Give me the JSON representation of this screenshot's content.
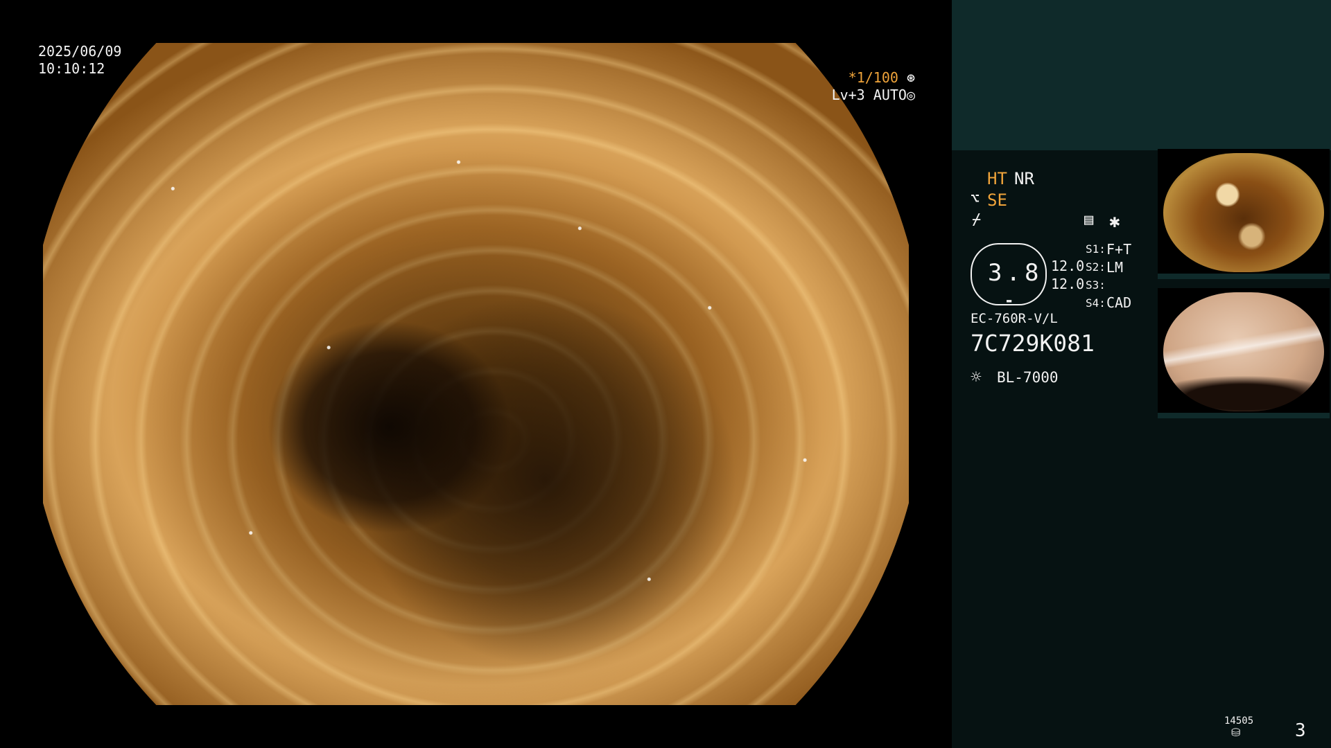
{
  "osd": {
    "date": "2025/06/09",
    "time": "10:10:12",
    "shutter": "*1/100",
    "level": "Lv+3",
    "auto": "AUTO"
  },
  "panel": {
    "mode1": "HT",
    "mode2": "NR",
    "mode3": "SE",
    "brightness": "3.8",
    "val1": "12.0",
    "val2": "12.0",
    "s1_label": "S1:",
    "s1_value": "F+T",
    "s2_label": "S2:",
    "s2_value": "LM",
    "s3_label": "S3:",
    "s3_value": "",
    "s4_label": "S4:",
    "s4_value": "CAD",
    "scope_model": "EC-760R-V/L",
    "scope_serial": "7C729K081",
    "light_source": "BL-7000",
    "counter": "14505",
    "page_number": "3"
  },
  "colors": {
    "orange_accent": "#f0a43a",
    "panel_bg": "#061212",
    "panel_top_bg": "#0f2a2a"
  },
  "icons": [
    "shutter-icon",
    "auto-icon",
    "scissor-icon",
    "pen-icon",
    "settings-list-icon",
    "asterisk-icon",
    "sun-icon",
    "storage-icon"
  ]
}
